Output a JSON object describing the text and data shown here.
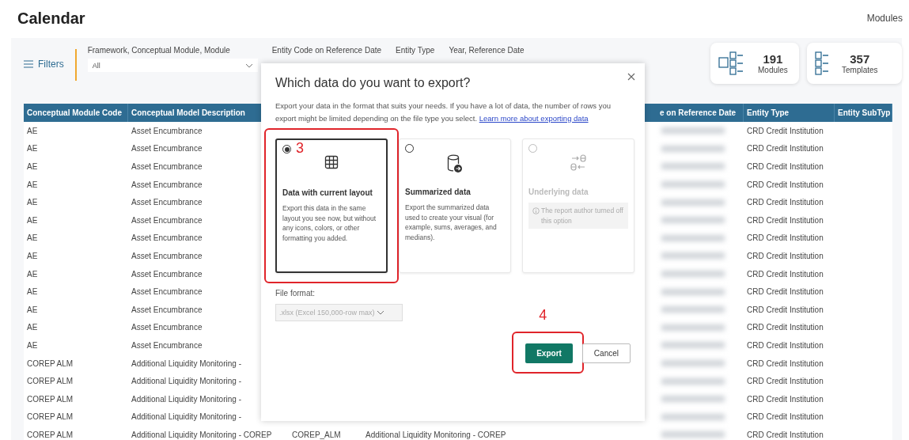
{
  "page": {
    "title": "Calendar",
    "nav_link": "Modules"
  },
  "filters": {
    "button": "Filters",
    "fields": [
      {
        "label": "Framework, Conceptual Module, Module",
        "value": "All"
      },
      {
        "label": "Entity Code on Reference Date"
      },
      {
        "label": "Entity Type"
      },
      {
        "label": "Year, Reference Date"
      }
    ]
  },
  "stats": [
    {
      "kind": "modules",
      "value": "191",
      "label": "Modules"
    },
    {
      "kind": "templates",
      "value": "357",
      "label": "Templates"
    }
  ],
  "table": {
    "columns": [
      "Conceptual Module Code",
      "Conceptual Model Description",
      "e on Reference Date",
      "Entity Type",
      "Entity SubTyp"
    ],
    "rows": [
      {
        "code": "AE",
        "description": "Asset Encumbrance",
        "entity_type": "CRD Credit Institution"
      },
      {
        "code": "AE",
        "description": "Asset Encumbrance",
        "entity_type": "CRD Credit Institution"
      },
      {
        "code": "AE",
        "description": "Asset Encumbrance",
        "entity_type": "CRD Credit Institution"
      },
      {
        "code": "AE",
        "description": "Asset Encumbrance",
        "entity_type": "CRD Credit Institution"
      },
      {
        "code": "AE",
        "description": "Asset Encumbrance",
        "entity_type": "CRD Credit Institution"
      },
      {
        "code": "AE",
        "description": "Asset Encumbrance",
        "entity_type": "CRD Credit Institution"
      },
      {
        "code": "AE",
        "description": "Asset Encumbrance",
        "entity_type": "CRD Credit Institution"
      },
      {
        "code": "AE",
        "description": "Asset Encumbrance",
        "entity_type": "CRD Credit Institution"
      },
      {
        "code": "AE",
        "description": "Asset Encumbrance",
        "entity_type": "CRD Credit Institution"
      },
      {
        "code": "AE",
        "description": "Asset Encumbrance",
        "entity_type": "CRD Credit Institution"
      },
      {
        "code": "AE",
        "description": "Asset Encumbrance",
        "entity_type": "CRD Credit Institution"
      },
      {
        "code": "AE",
        "description": "Asset Encumbrance",
        "entity_type": "CRD Credit Institution"
      },
      {
        "code": "AE",
        "description": "Asset Encumbrance",
        "entity_type": "CRD Credit Institution"
      },
      {
        "code": "COREP ALM",
        "description": "Additional Liquidity Monitoring -",
        "entity_type": "CRD Credit Institution"
      },
      {
        "code": "COREP ALM",
        "description": "Additional Liquidity Monitoring -",
        "entity_type": "CRD Credit Institution"
      },
      {
        "code": "COREP ALM",
        "description": "Additional Liquidity Monitoring -",
        "entity_type": "CRD Credit Institution"
      },
      {
        "code": "COREP ALM",
        "description": "Additional Liquidity Monitoring -",
        "entity_type": "CRD Credit Institution"
      },
      {
        "code": "COREP ALM",
        "description": "Additional Liquidity Monitoring - COREP",
        "module_code": "COREP_ALM",
        "module_description": "Additional Liquidity Monitoring - COREP",
        "entity_type": "CRD Credit Institution"
      }
    ]
  },
  "export_dialog": {
    "title": "Which data do you want to export?",
    "description": "Export your data in the format that suits your needs. If you have a lot of data, the number of rows you export might be limited depending on the file type you select.",
    "link": "Learn more about exporting data",
    "options": [
      {
        "kind": "layout",
        "title": "Data with current layout",
        "description": "Export this data in the same layout you see now, but without any icons, colors, or other formatting you added.",
        "selected": true,
        "disabled": false,
        "annotation": "3"
      },
      {
        "kind": "summarized",
        "title": "Summarized data",
        "description": "Export the summarized data used to create your visual (for example, sums, averages, and medians).",
        "selected": false,
        "disabled": false
      },
      {
        "kind": "underlying",
        "title": "Underlying data",
        "note": "The report author turned off this option",
        "selected": false,
        "disabled": true
      }
    ],
    "file_format": {
      "label": "File format:",
      "value": ".xlsx (Excel 150,000-row max)",
      "disabled": true
    },
    "buttons": [
      {
        "kind": "primary",
        "label": "Export",
        "annotation": "4"
      },
      {
        "kind": "secondary",
        "label": "Cancel"
      }
    ]
  }
}
